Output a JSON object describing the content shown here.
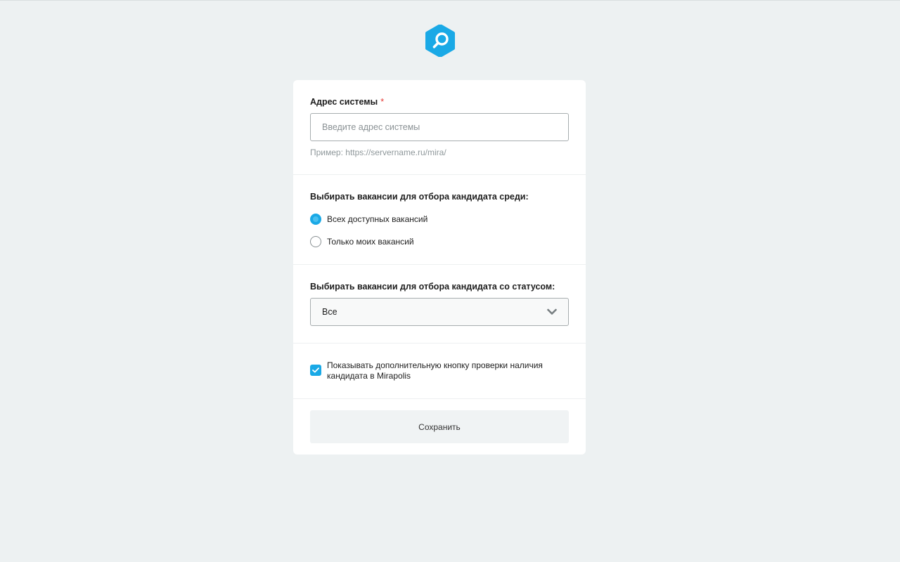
{
  "brand": {
    "logo_icon": "search-icon",
    "accent_color": "#1aa9e6"
  },
  "system_address": {
    "label": "Адрес системы",
    "required_mark": "*",
    "value": "",
    "placeholder": "Введите адрес системы",
    "hint": "Пример: https://servername.ru/mira/"
  },
  "vacancy_scope": {
    "label": "Выбирать вакансии для отбора кандидата среди:",
    "options": [
      {
        "label": "Всех доступных вакансий",
        "checked": true
      },
      {
        "label": "Только моих вакансий",
        "checked": false
      }
    ]
  },
  "vacancy_status": {
    "label": "Выбирать вакансии для отбора кандидата со статусом:",
    "selected": "Все"
  },
  "extra_check": {
    "label": "Показывать дополнительную кнопку проверки наличия кандидата в Mirapolis",
    "checked": true
  },
  "actions": {
    "save_label": "Сохранить"
  }
}
